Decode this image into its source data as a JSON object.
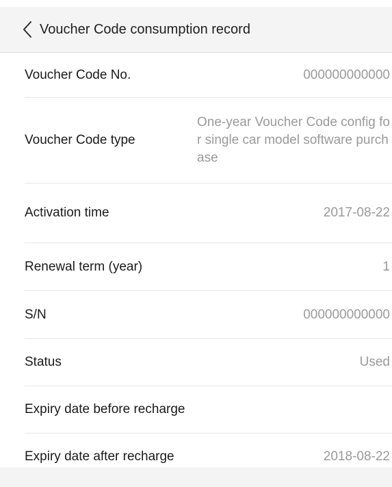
{
  "nav": {
    "back_icon": "chevron-left-icon",
    "title": "Voucher Code consumption record"
  },
  "record": {
    "rows": [
      {
        "label": "Voucher Code No.",
        "value": "000000000000"
      },
      {
        "label": "Voucher Code type",
        "value": "One-year Voucher Code config for single car model software purchase"
      },
      {
        "label": "Activation time",
        "value": "2017-08-22"
      },
      {
        "label": "Renewal term (year)",
        "value": "1"
      },
      {
        "label": "S/N",
        "value": "000000000000"
      },
      {
        "label": "Status",
        "value": "Used"
      },
      {
        "label": "Expiry date before recharge",
        "value": ""
      },
      {
        "label": "Expiry date after recharge",
        "value": "2018-08-22"
      }
    ]
  },
  "colors": {
    "nav_background": "#f4f4f4",
    "label_text": "#1a1a1a",
    "value_text": "#9a9a9a",
    "divider": "#e6e6e6"
  }
}
